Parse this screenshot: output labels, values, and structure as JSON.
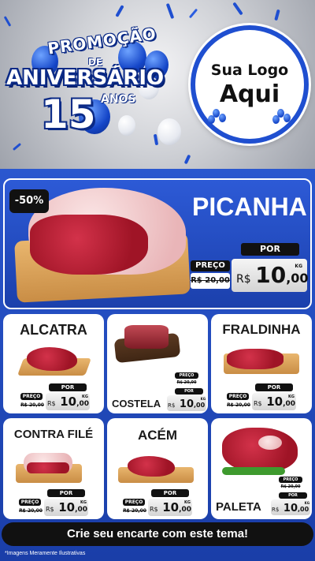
{
  "header": {
    "promo_line1": "PROMOÇÃO",
    "promo_line2": "DE",
    "promo_line3": "ANIVERSÁRIO",
    "promo_number": "15",
    "promo_years": "ANOS",
    "logo_line1": "Sua Logo",
    "logo_line2": "Aqui"
  },
  "featured": {
    "name": "PICANHA",
    "discount": "-50%",
    "label_preco": "PREÇO",
    "label_por": "POR",
    "old_price": "R$ 20,00",
    "currency": "R$",
    "price_int": "10",
    "price_dec": ",00",
    "unit": "KG"
  },
  "products": [
    {
      "name": "ALCATRA",
      "label_preco": "PREÇO",
      "label_por": "POR",
      "old_price": "R$ 20,00",
      "currency": "R$",
      "price_int": "10",
      "price_dec": ",00",
      "unit": "KG"
    },
    {
      "name": "COSTELA",
      "label_preco": "PREÇO",
      "label_por": "POR",
      "old_price": "R$ 20,00",
      "currency": "R$",
      "price_int": "10",
      "price_dec": ",00",
      "unit": "KG"
    },
    {
      "name": "FRALDINHA",
      "label_preco": "PREÇO",
      "label_por": "POR",
      "old_price": "R$ 20,00",
      "currency": "R$",
      "price_int": "10",
      "price_dec": ",00",
      "unit": "KG"
    },
    {
      "name": "CONTRA FILÉ",
      "label_preco": "PREÇO",
      "label_por": "POR",
      "old_price": "R$ 20,00",
      "currency": "R$",
      "price_int": "10",
      "price_dec": ",00",
      "unit": "KG"
    },
    {
      "name": "ACÉM",
      "label_preco": "PREÇO",
      "label_por": "POR",
      "old_price": "R$ 20,00",
      "currency": "R$",
      "price_int": "10",
      "price_dec": ",00",
      "unit": "KG"
    },
    {
      "name": "PALETA",
      "label_preco": "PREÇO",
      "label_por": "POR",
      "old_price": "R$ 20,00",
      "currency": "R$",
      "price_int": "10",
      "price_dec": ",00",
      "unit": "KG"
    }
  ],
  "footer": {
    "cta": "Crie seu encarte com este tema!",
    "disclaimer": "*Imagens Meramente Ilustrativas"
  },
  "colors": {
    "brand_blue": "#1f4fd0",
    "dark": "#111111",
    "meat_red": "#b51c30"
  }
}
